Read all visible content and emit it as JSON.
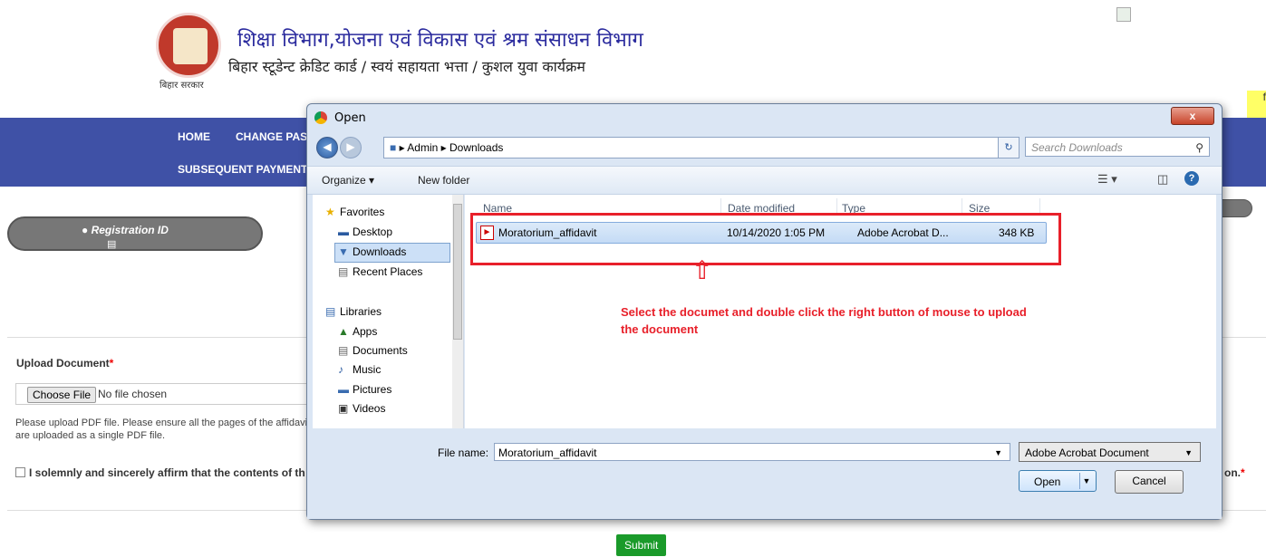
{
  "header": {
    "emblem_caption": "बिहार सरकार",
    "title": "शिक्षा विभाग,योजना एवं विकास एवं श्रम संसाधन विभाग",
    "subtitle": "बिहार स्टूडेन्ट क्रेडिट कार्ड / स्वयं सहायता भत्ता / कुशल युवा कार्यक्रम",
    "yellow_tab_text": "f"
  },
  "nav": {
    "items": [
      "HOME",
      "CHANGE PAS",
      "SUBSEQUENT PAYMENT"
    ]
  },
  "registration": {
    "label": "Registration ID"
  },
  "upload": {
    "label": "Upload Document",
    "required_mark": "*",
    "choose_button": "Choose File",
    "no_file_text": "No file chosen",
    "help_text": "Please upload PDF file. Please ensure all the pages of the affidavit are uploaded as a single PDF file.",
    "affirm_text": "I solemnly and sincerely affirm that the contents of th",
    "affirm_tail": "on.",
    "submit_label": "Submit"
  },
  "dialog": {
    "title": "Open",
    "close_glyph": "x",
    "breadcrumb": [
      "Admin",
      "Downloads"
    ],
    "search_placeholder": "Search Downloads",
    "toolbar": {
      "organize": "Organize ▾",
      "new_folder": "New folder"
    },
    "favorites_header": "Favorites",
    "favorites": [
      "Desktop",
      "Downloads",
      "Recent Places"
    ],
    "libraries_header": "Libraries",
    "libraries": [
      "Apps",
      "Documents",
      "Music",
      "Pictures",
      "Videos"
    ],
    "columns": [
      "Name",
      "Date modified",
      "Type",
      "Size"
    ],
    "files": [
      {
        "name": "Moratorium_affidavit",
        "date_modified": "10/14/2020 1:05 PM",
        "type": "Adobe Acrobat D...",
        "size": "348 KB"
      }
    ],
    "annotation_arrow": "⇧",
    "annotation_text": "Select the documet and double click the right button of mouse to upload the document",
    "file_name_label": "File name:",
    "file_name_value": "Moratorium_affidavit",
    "file_type_value": "Adobe Acrobat Document",
    "open_button": "Open",
    "cancel_button": "Cancel"
  },
  "colors": {
    "nav_bg": "#3f51a6",
    "annotation_red": "#e8202a",
    "submit_green": "#1a9a2a"
  }
}
